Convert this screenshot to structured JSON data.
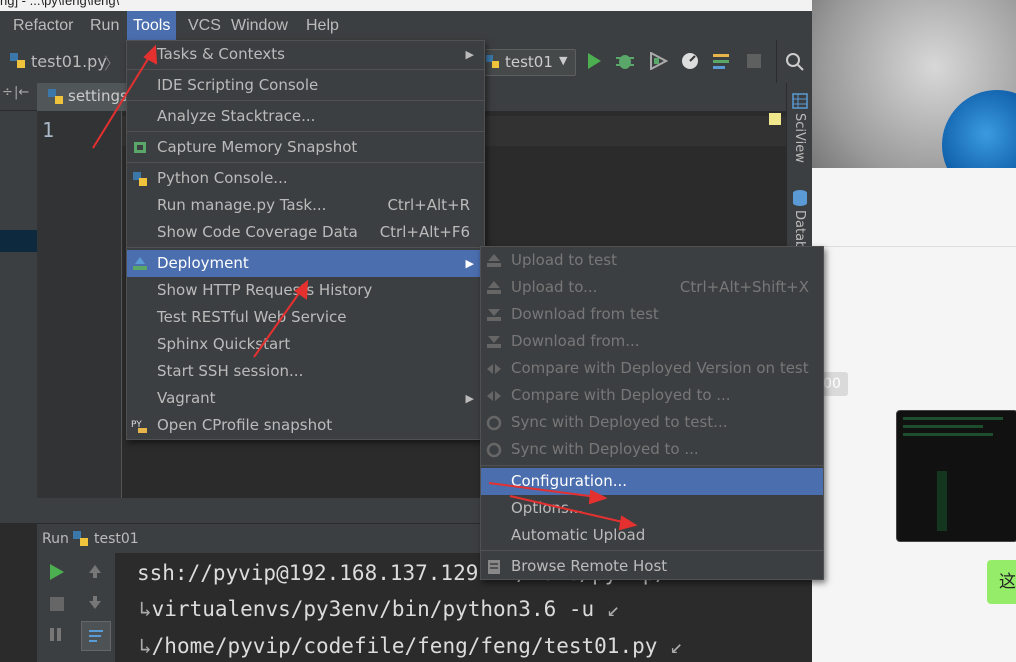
{
  "menubar": {
    "items": [
      "Refactor",
      "Run",
      "Tools",
      "VCS",
      "Window",
      "Help"
    ]
  },
  "toolbar": {
    "file_crumb": "test01.py",
    "run_config": "test01"
  },
  "editor": {
    "tab_label": "settings",
    "line_number": "1"
  },
  "right_strip": {
    "sciview": "SciView",
    "database": "Datab"
  },
  "tools_menu": {
    "items": [
      {
        "label": "Tasks & Contexts",
        "arrow": "▶"
      },
      {
        "label": "IDE Scripting Console"
      },
      {
        "label": "Analyze Stacktrace..."
      },
      {
        "label": "Capture Memory Snapshot"
      },
      {
        "label": "Python Console..."
      },
      {
        "label": "Run manage.py Task...",
        "shortcut": "Ctrl+Alt+R"
      },
      {
        "label": "Show Code Coverage Data",
        "shortcut": "Ctrl+Alt+F6"
      },
      {
        "label": "Deployment",
        "arrow": "▶"
      },
      {
        "label": "Show HTTP Requests History"
      },
      {
        "label": "Test RESTful Web Service"
      },
      {
        "label": "Sphinx Quickstart"
      },
      {
        "label": "Start SSH session..."
      },
      {
        "label": "Vagrant",
        "arrow": "▶"
      },
      {
        "label": "Open CProfile snapshot"
      }
    ]
  },
  "deployment_menu": {
    "items": [
      {
        "label": "Upload to test"
      },
      {
        "label": "Upload to...",
        "shortcut": "Ctrl+Alt+Shift+X"
      },
      {
        "label": "Download from test"
      },
      {
        "label": "Download from..."
      },
      {
        "label": "Compare with Deployed Version on test"
      },
      {
        "label": "Compare with Deployed to ..."
      },
      {
        "label": "Sync with Deployed to test..."
      },
      {
        "label": "Sync with Deployed to ..."
      },
      {
        "label": "Configuration..."
      },
      {
        "label": "Options..."
      },
      {
        "label": "Automatic Upload"
      },
      {
        "label": "Browse Remote Host"
      }
    ]
  },
  "run_panel": {
    "tab": "Run",
    "config": "test01",
    "lines": [
      "ssh://pyvip@192.168.137.129:22/home/pyvip/",
      "virtualenvs/py3env/bin/python3.6 -u",
      "/home/pyvip/codefile/feng/feng/test01.py"
    ]
  },
  "right_image": {
    "badge": "00",
    "chat_bubble": "这"
  },
  "colors": {
    "menu_bg": "#3c3f41",
    "selection": "#4b6eaf",
    "arrow_red": "#e53030"
  }
}
